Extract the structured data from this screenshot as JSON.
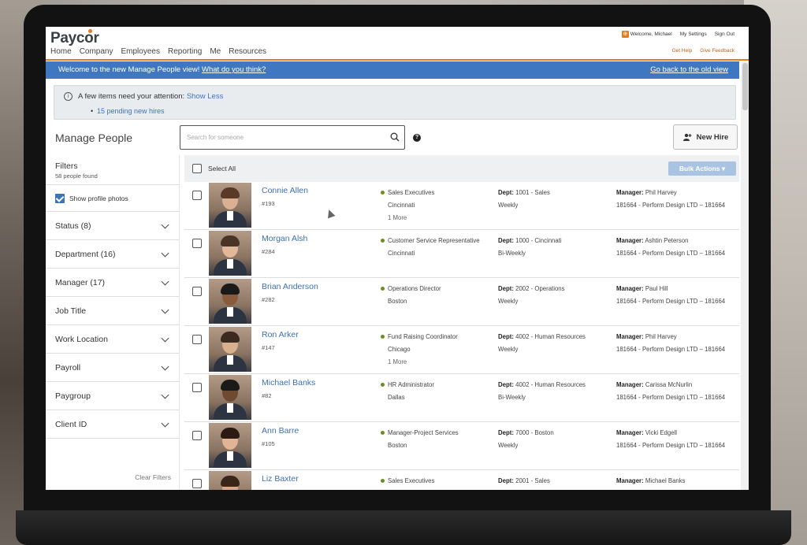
{
  "header": {
    "logo": "Paycor",
    "nav": [
      "Home",
      "Company",
      "Employees",
      "Reporting",
      "Me",
      "Resources"
    ],
    "welcome": "Welcome, Michael",
    "my_settings": "My Settings",
    "sign_out": "Sign Out",
    "get_help": "Get Help",
    "give_feedback": "Give Feedback",
    "accent": "#e57c1c"
  },
  "banner": {
    "text": "Welcome to the new Manage People view! ",
    "link": "What do you think?",
    "right_link": "Go back to the old view",
    "color": "#3f78c0"
  },
  "attention": {
    "text": "A few items need your attention: ",
    "show_less": "Show Less",
    "item": "15 pending new hires"
  },
  "toolbar": {
    "title": "Manage People",
    "search_placeholder": "Search for someone",
    "new_hire": "New Hire"
  },
  "sidebar": {
    "filters_title": "Filters",
    "people_found": "58 people found",
    "show_photos": "Show profile photos",
    "filters": [
      "Status (8)",
      "Department (16)",
      "Manager (17)",
      "Job Title",
      "Work Location",
      "Payroll",
      "Paygroup",
      "Client ID"
    ],
    "clear_filters": "Clear Filters"
  },
  "list": {
    "select_all": "Select All",
    "bulk_actions": "Bulk Actions",
    "dept_label": "Dept:",
    "manager_label": "Manager:",
    "people": [
      {
        "name": "Connie Allen",
        "id": "#193",
        "title": "Sales Executives",
        "location": "Cincinnati",
        "more": "1 More",
        "dept": "1001 - Sales",
        "pay": "Weekly",
        "manager": "Phil Harvey",
        "company": "181664 - Perform Design LTD – 181664"
      },
      {
        "name": "Morgan Alsh",
        "id": "#284",
        "title": "Customer Service Representative",
        "location": "Cincinnati",
        "more": "",
        "dept": "1000 - Cincinnati",
        "pay": "Bi-Weekly",
        "manager": "Ashtin Peterson",
        "company": "181664 - Perform Design LTD – 181664"
      },
      {
        "name": "Brian Anderson",
        "id": "#282",
        "title": "Operations Director",
        "location": "Boston",
        "more": "",
        "dept": "2002 - Operations",
        "pay": "Weekly",
        "manager": "Paul Hill",
        "company": "181664 - Perform Design LTD – 181664"
      },
      {
        "name": "Ron Arker",
        "id": "#147",
        "title": "Fund Raising Coordinator",
        "location": "Chicago",
        "more": "1 More",
        "dept": "4002 - Human Resources",
        "pay": "Weekly",
        "manager": "Phil Harvey",
        "company": "181664 - Perform Design LTD – 181664"
      },
      {
        "name": "Michael Banks",
        "id": "#82",
        "title": "HR Administrator",
        "location": "Dallas",
        "more": "",
        "dept": "4002 - Human Resources",
        "pay": "Bi-Weekly",
        "manager": "Carissa McNurlin",
        "company": "181664 - Perform Design LTD – 181664"
      },
      {
        "name": "Ann Barre",
        "id": "#105",
        "title": "Manager-Project Services",
        "location": "Boston",
        "more": "",
        "dept": "7000 - Boston",
        "pay": "Weekly",
        "manager": "Vicki Edgell",
        "company": "181664 - Perform Design LTD – 181664"
      },
      {
        "name": "Liz Baxter",
        "id": "",
        "title": "Sales Executives",
        "location": "",
        "more": "",
        "dept": "2001 - Sales",
        "pay": "",
        "manager": "Michael Banks",
        "company": ""
      }
    ]
  }
}
